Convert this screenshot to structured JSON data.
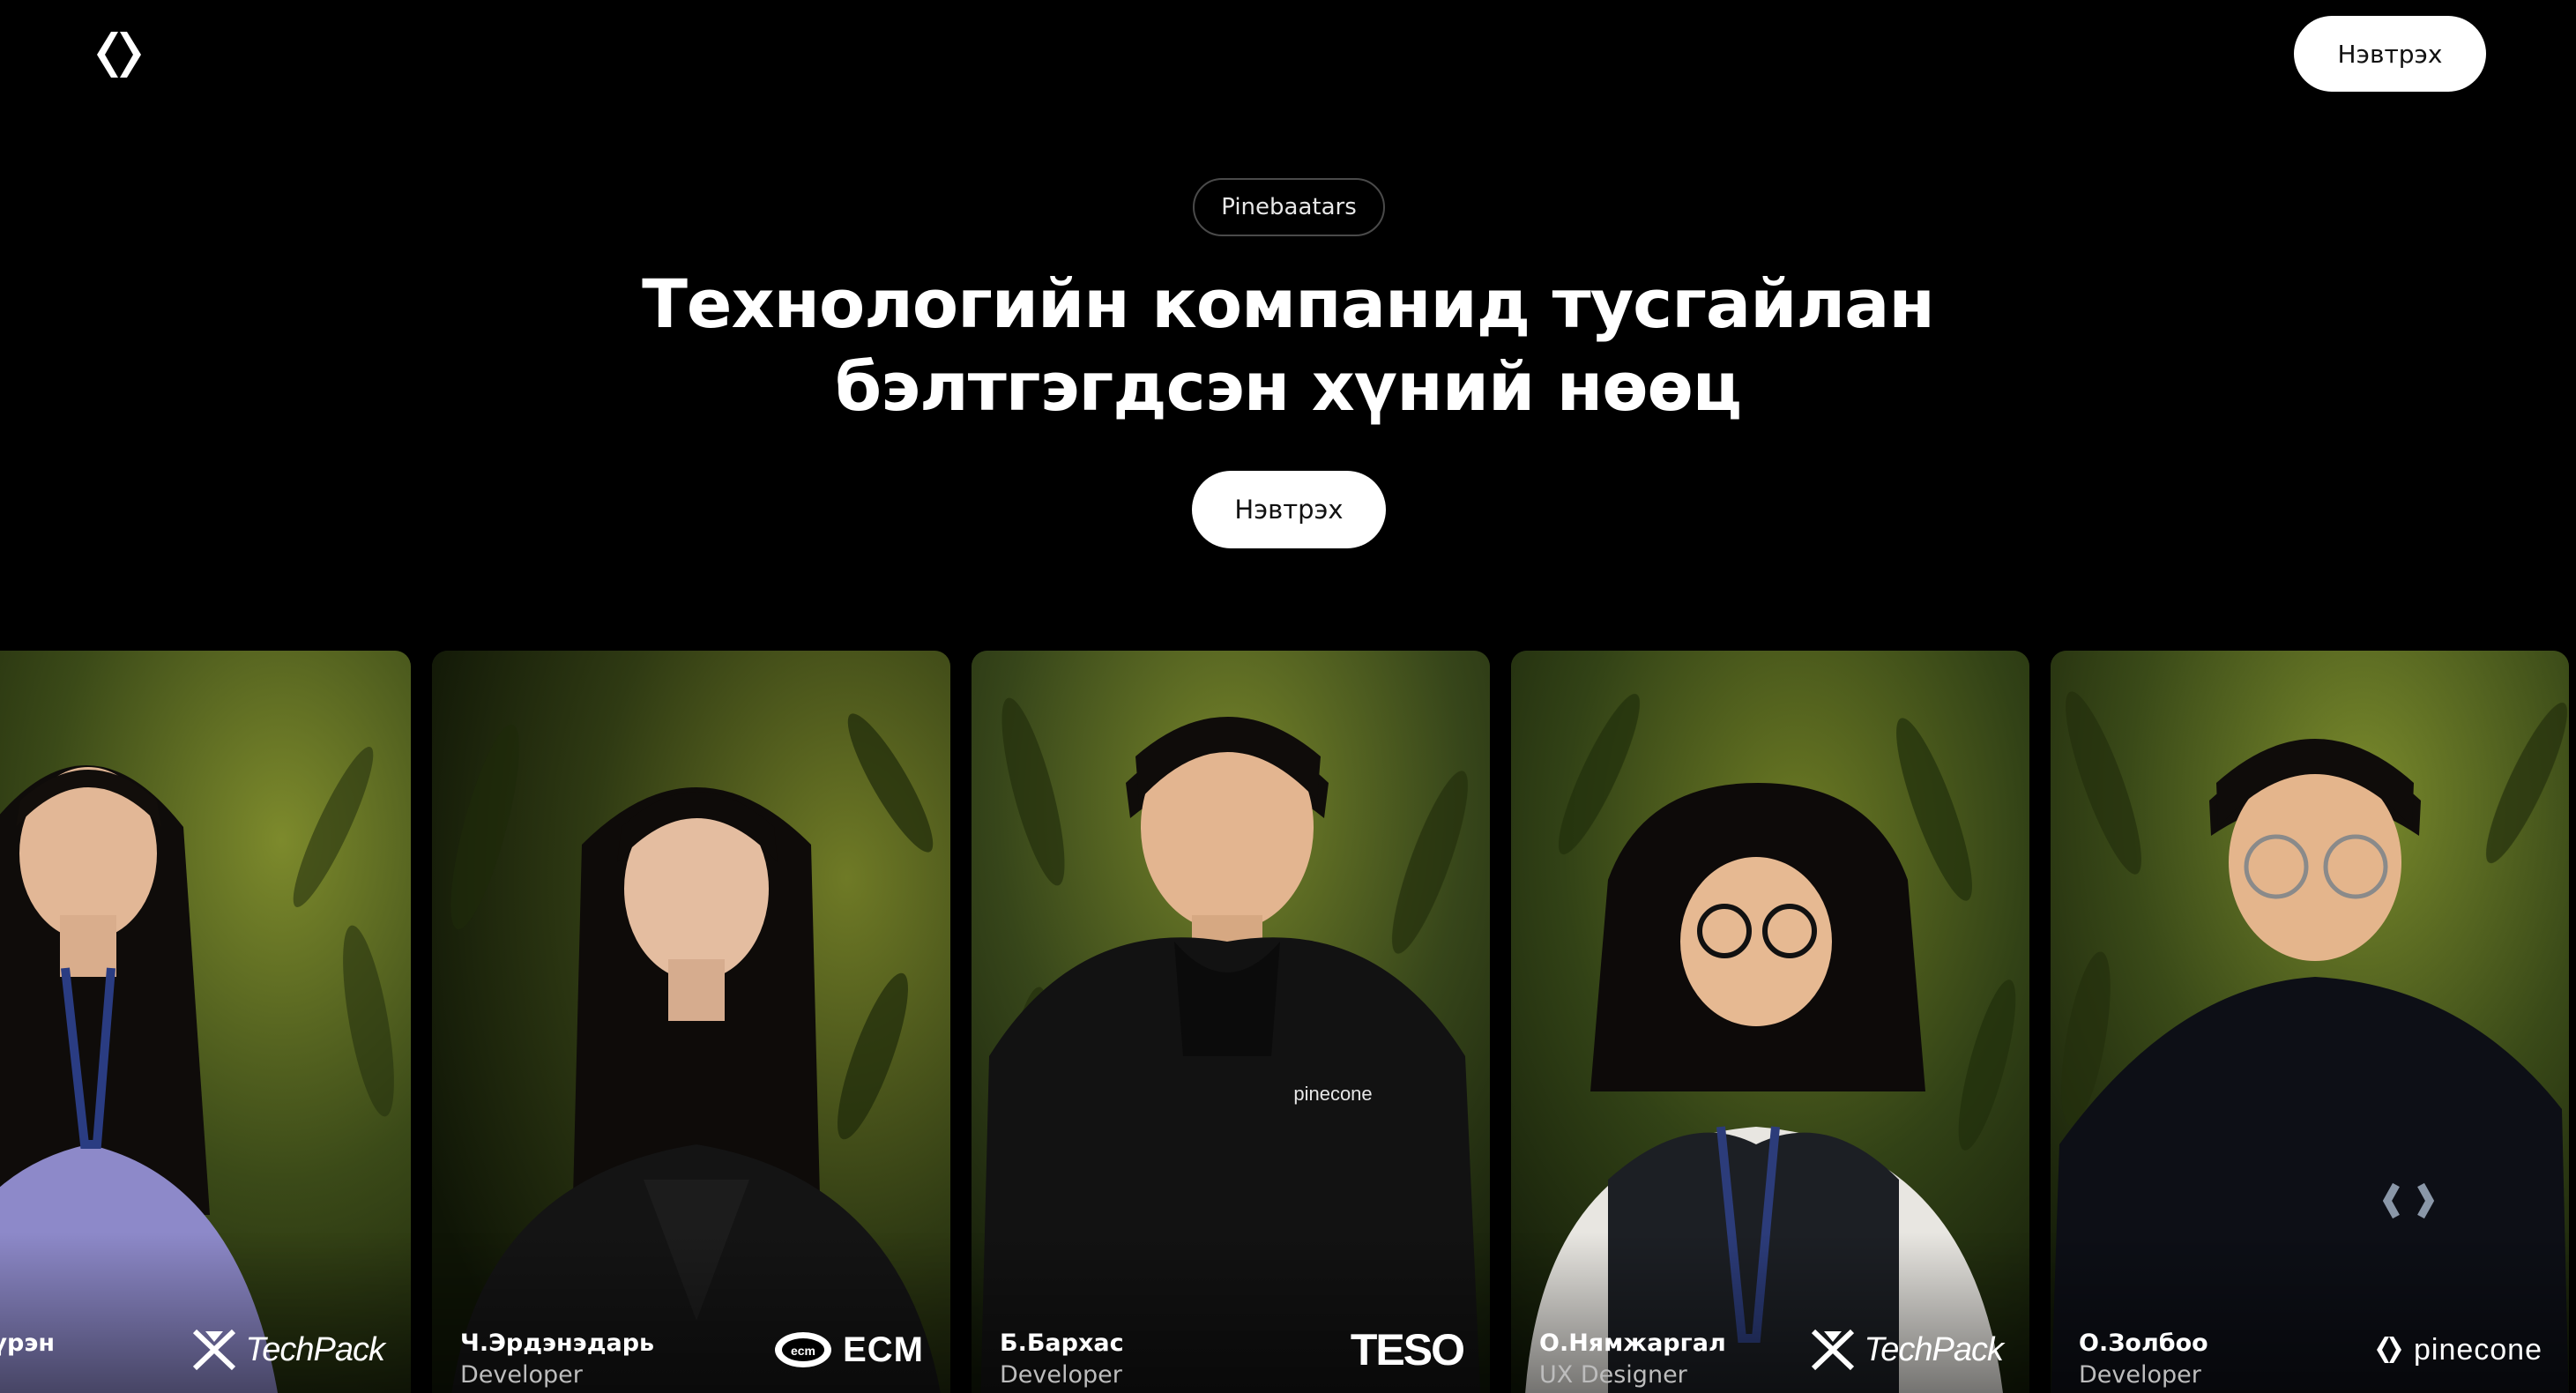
{
  "header": {
    "logo_icon": "brackets-logo-icon",
    "login_label": "Нэвтрэх"
  },
  "hero": {
    "badge": "Pinebaatars",
    "title_line1": "Технологийн компанид тусгайлан",
    "title_line2": "бэлтгэгдсэн хүний нөөц",
    "cta_label": "Нэвтрэх"
  },
  "profiles": [
    {
      "name": "жинсүрэн",
      "role": "per",
      "company": "TechPack",
      "company_icon": "techpack-logo-icon",
      "shirt_color": "#8d89c9"
    },
    {
      "name": "Ч.Эрдэнэдарь",
      "role": "Developer",
      "company": "ECM",
      "company_icon": "ecm-logo-icon",
      "shirt_color": "#141414"
    },
    {
      "name": "Б.Бархас",
      "role": "Developer",
      "company": "TESO",
      "company_icon": "teso-logo-icon",
      "shirt_color": "#121212"
    },
    {
      "name": "О.Нямжаргал",
      "role": "UX Designer",
      "company": "TechPack",
      "company_icon": "techpack-logo-icon",
      "shirt_color": "#1c1f24"
    },
    {
      "name": "О.Золбоо",
      "role": "Developer",
      "company": "pinecone",
      "company_icon": "pinecone-logo-icon",
      "shirt_color": "#0d0f16"
    }
  ],
  "colors": {
    "background": "#000000",
    "button_bg": "#ffffff",
    "button_text": "#111111",
    "foliage_dark": "#1d2410",
    "foliage_light": "#6f7a26"
  }
}
